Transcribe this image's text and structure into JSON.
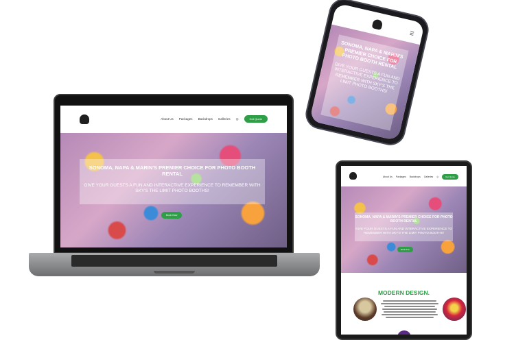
{
  "site": {
    "nav": [
      "About Us",
      "Packages",
      "Backdrops",
      "Galleries"
    ],
    "cta": "Get Quote",
    "hero_title": "Sonoma, Napa & Marin's Premier Choice for Photo Booth Rental",
    "hero_subtitle": "Give your guests a fun and interactive experience to remember with Sky's the limit photo booths!",
    "hero_button": "Book Now",
    "section_title": "MODERN DESIGN.",
    "menu_icon": "hamburger-menu-icon",
    "social_icon": "instagram-icon"
  },
  "colors": {
    "accent": "#2e9e47",
    "device": "#1b1b1f",
    "laptop_base": "#8f9092"
  }
}
